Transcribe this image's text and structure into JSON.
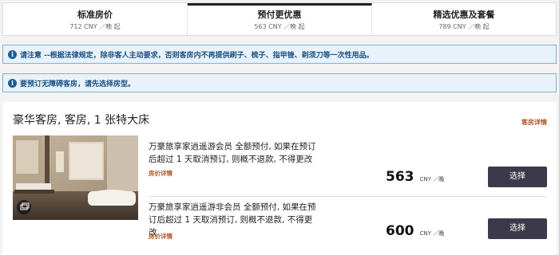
{
  "tabs": [
    {
      "title": "标准房价",
      "price": "712 CNY ／晚 起"
    },
    {
      "title": "预付更优惠",
      "price": "563 CNY ／晚 起"
    },
    {
      "title": "精选优惠及套餐",
      "price": "789 CNY ／晚 起"
    }
  ],
  "active_tab": 1,
  "notices": [
    {
      "text": "请注意 --根据法律规定，除非客人主动要求，否则客房内不再提供刷子、梳子、指甲锉、剃须刀等一次性用品。"
    },
    {
      "text": "要预订无障碍客房，请先选择房型。"
    }
  ],
  "room": {
    "title": "豪华客房, 客房, 1 张特大床",
    "details_link": "客房详情",
    "rates": [
      {
        "description": "万豪旅享家逍遥游会员 全额预付, 如果在预订后超过 1 天取消预订, 则概不退款, 不得更改",
        "details_link": "房价详情",
        "price": "563",
        "unit": "CNY ／晚",
        "button": "选择"
      },
      {
        "description": "万豪旅享家逍遥游非会员 全额预付, 如果在预订后超过 1 天取消预订, 则概不退款, 不得更改",
        "details_link": "房价详情",
        "price": "600",
        "unit": "CNY ／晚",
        "button": "选择"
      }
    ]
  },
  "icons": {
    "info": "info-icon",
    "gallery": "gallery-icon"
  },
  "colors": {
    "notice_bg": "#e8f2fb",
    "notice_border": "#7fb1d8",
    "link": "#b0531f",
    "button": "#3c3a4a"
  }
}
